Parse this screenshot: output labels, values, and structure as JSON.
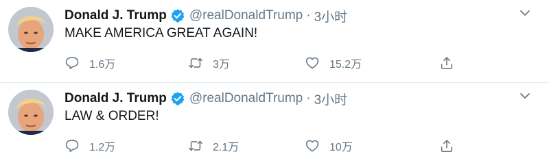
{
  "colors": {
    "text": "#14171a",
    "secondary": "#657786",
    "verified": "#1da1f2",
    "divider": "#e6ecf0"
  },
  "icons": {
    "verified": "verified-badge-icon",
    "caret": "chevron-down-icon",
    "reply": "reply-icon",
    "retweet": "retweet-icon",
    "like": "like-icon",
    "share": "share-icon"
  },
  "tweets": [
    {
      "name": "Donald J. Trump",
      "handle": "@realDonaldTrump",
      "separator": "·",
      "time": "3小时",
      "text": "MAKE AMERICA GREAT AGAIN!",
      "replies": "1.6万",
      "retweets": "3万",
      "likes": "15.2万"
    },
    {
      "name": "Donald J. Trump",
      "handle": "@realDonaldTrump",
      "separator": "·",
      "time": "3小时",
      "text": "LAW & ORDER!",
      "replies": "1.2万",
      "retweets": "2.1万",
      "likes": "10万"
    }
  ]
}
